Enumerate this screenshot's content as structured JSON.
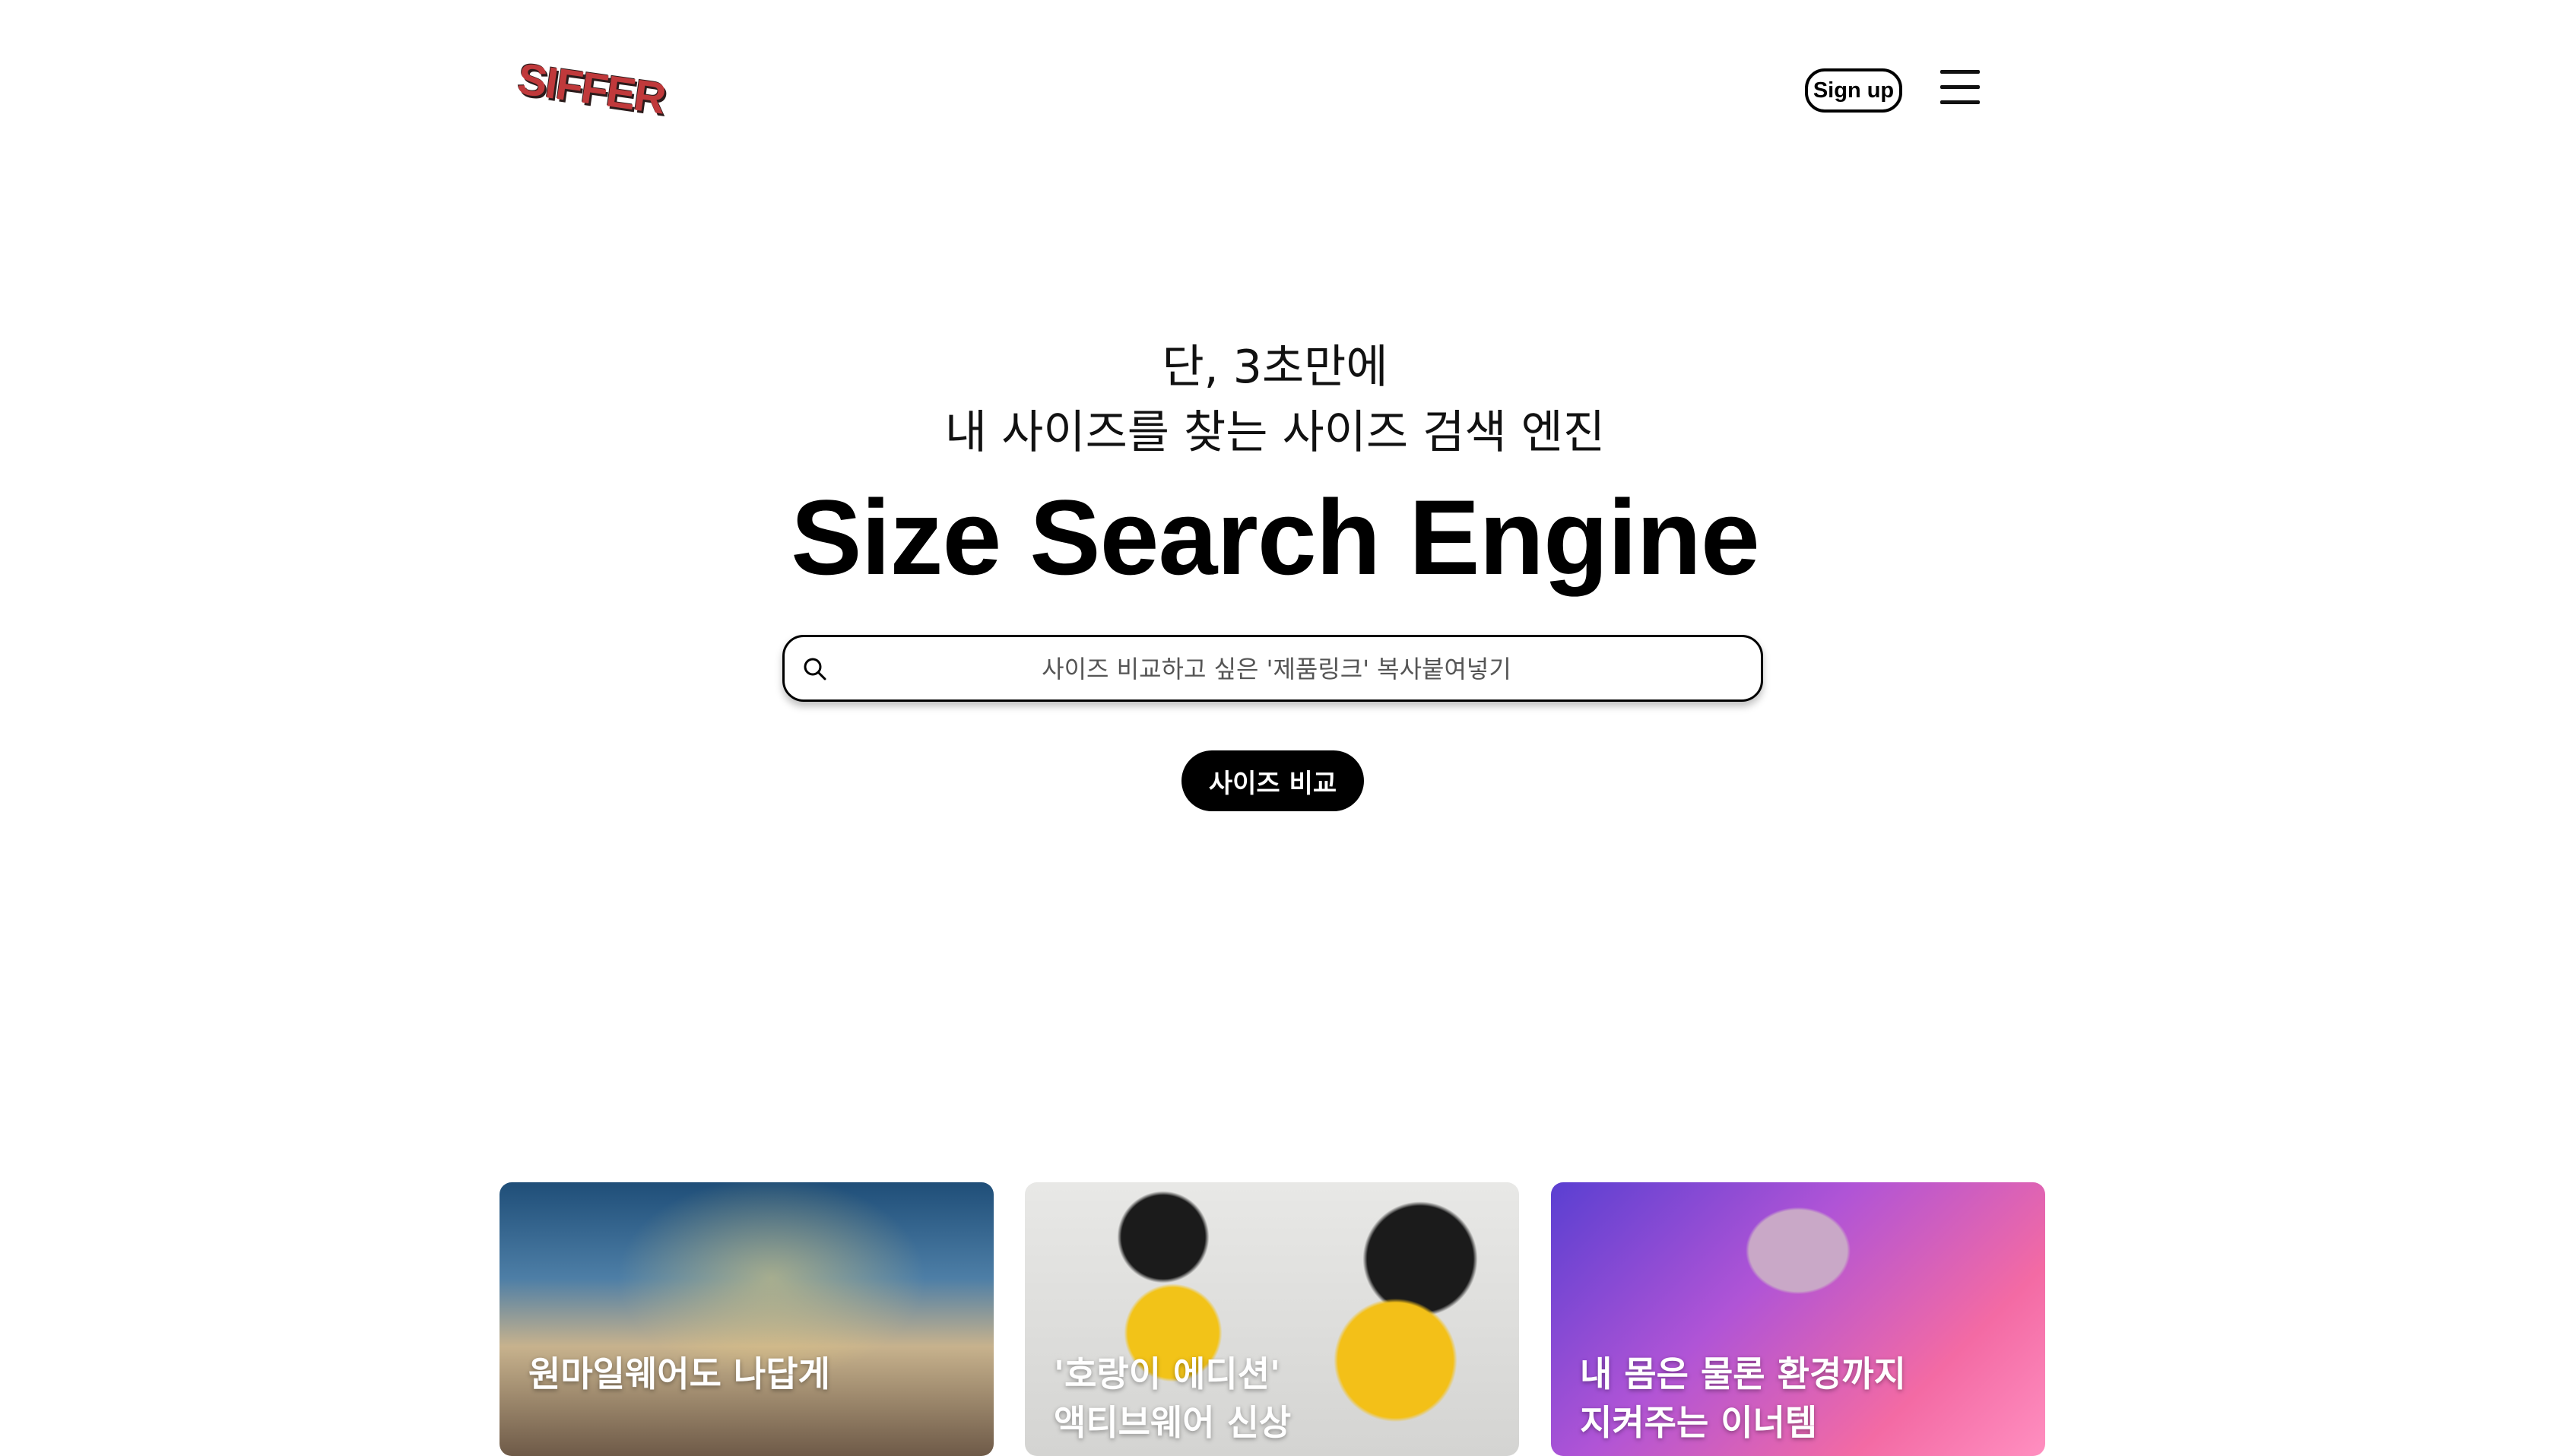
{
  "header": {
    "logo_text": "SIFFER",
    "signup_label": "Sign up",
    "menu_icon": "hamburger-menu-icon"
  },
  "hero": {
    "subtitle_line1": "단, 3초만에",
    "subtitle_line2": "내 사이즈를 찾는 사이즈 검색 엔진",
    "title": "Size Search Engine"
  },
  "search": {
    "placeholder": "사이즈 비교하고 싶은 '제품링크' 복사붙여넣기",
    "value": "",
    "icon": "search-icon"
  },
  "compare_button_label": "사이즈 비교",
  "cards": [
    {
      "title": "원마일웨어도 나답게"
    },
    {
      "title": "'호랑이 에디션'\n액티브웨어 신상"
    },
    {
      "title": "내 몸은 물론 환경까지\n지켜주는 이너템"
    }
  ]
}
